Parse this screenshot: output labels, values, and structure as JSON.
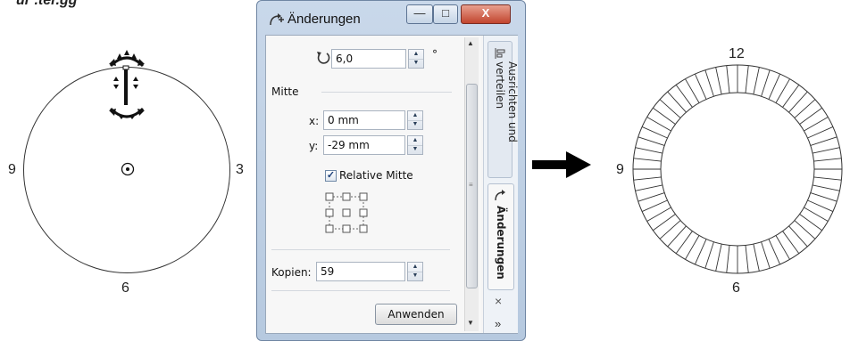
{
  "caption": "ur .ter.gg",
  "left_figure": {
    "labels": {
      "top": "",
      "right": "3",
      "bottom": "6",
      "left": "9"
    }
  },
  "dialog": {
    "title": "Änderungen",
    "titlebar_buttons": {
      "minimize": "—",
      "maximize": "□",
      "close": "X"
    },
    "rotation": {
      "value": "6,0",
      "unit": "°"
    },
    "center_section": "Mitte",
    "x": {
      "label": "x:",
      "value": "0 mm"
    },
    "y": {
      "label": "y:",
      "value": "-29 mm"
    },
    "relative_center": {
      "label": "Relative Mitte",
      "checked": "✓"
    },
    "copies": {
      "label": "Kopien:",
      "value": "59"
    },
    "apply_button": "Anwenden",
    "side_tabs": {
      "align": "Ausrichten und verteilen",
      "changes": "Änderungen"
    },
    "side_close": "×",
    "side_more": "»"
  },
  "right_figure": {
    "labels": {
      "top": "12",
      "left": "9",
      "bottom": "6"
    },
    "tick_count": 60
  }
}
